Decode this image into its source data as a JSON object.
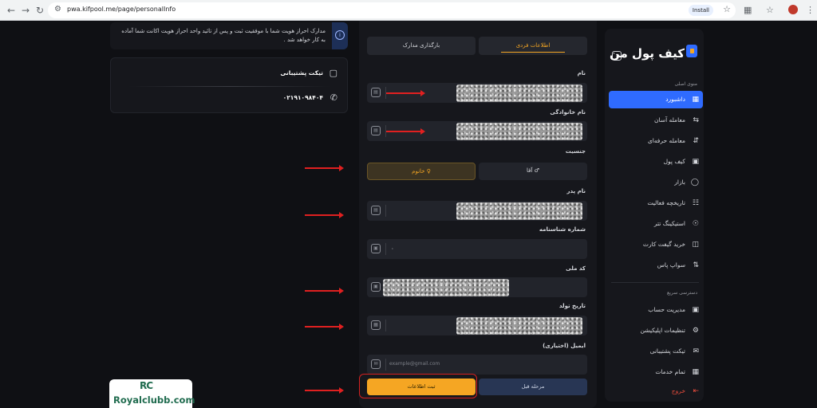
{
  "browser": {
    "url": "pwa.kifpool.me/page/personalInfo",
    "install_label": "Install",
    "back_icon": "arrow-left-icon",
    "forward_icon": "arrow-right-icon",
    "reload_icon": "reload-icon"
  },
  "sidebar": {
    "brand": "کیف پول من",
    "section_main": "منوی اصلی",
    "section_quick": "دسترسی سریع",
    "accent": "#2f6bff",
    "items": [
      {
        "label": "داشبورد",
        "icon": "dashboard-icon",
        "active": true
      },
      {
        "label": "معامله آسان",
        "icon": "easy-trade-icon"
      },
      {
        "label": "معامله حرفه‌ای",
        "icon": "pro-trade-icon"
      },
      {
        "label": "کیف پول",
        "icon": "wallet-icon"
      },
      {
        "label": "بازار",
        "icon": "market-icon"
      },
      {
        "label": "تاریخچه فعالیت",
        "icon": "history-icon"
      },
      {
        "label": "استیکینگ تتر",
        "icon": "staking-icon"
      },
      {
        "label": "خرید گیفت کارت",
        "icon": "gift-card-icon"
      },
      {
        "label": "سواپ پاس",
        "icon": "swap-icon"
      }
    ],
    "quick_items": [
      {
        "label": "مدیریت حساب",
        "icon": "account-icon"
      },
      {
        "label": "تنظیمات اپلیکیشن",
        "icon": "settings-icon"
      },
      {
        "label": "تیکت پشتیبانی",
        "icon": "ticket-icon"
      },
      {
        "label": "تمام خدمات",
        "icon": "grid-icon"
      }
    ],
    "logout": "خروج"
  },
  "form": {
    "tabs": {
      "personal": "اطلاعات فردی",
      "documents": "بارگذاری مدارک"
    },
    "active_tab": "personal",
    "labels": {
      "first_name": "نام",
      "last_name": "نام خانوادگی",
      "gender": "جنسیت",
      "father_name": "نام پدر",
      "id_number": "شماره شناسنامه",
      "national_code": "کد ملی",
      "birth_date": "تاریخ تولد",
      "email": "ایمیل (اختیاری)"
    },
    "id_number_value": "۰",
    "email_placeholder": "example@gmail.com",
    "gender_options": {
      "male": "آقا",
      "female": "خانوم"
    },
    "gender_selected": "female",
    "prev_button": "مرحله قبل",
    "submit_button": "ثبت اطلاعات",
    "accent": "#f5a623"
  },
  "notice": {
    "text": "مدارک احراز هویت شما با موفقیت ثبت و پس از تائید واحد احراز هویت اکانت شما آماده به کار خواهد شد .",
    "icon": "info-icon"
  },
  "support": {
    "ticket_label": "تیکت پشتیبانی",
    "phone": "۰۲۱۹۱۰۹۸۴۰۴",
    "ticket_icon": "chat-icon",
    "phone_icon": "phone-icon"
  },
  "watermark": {
    "mark": "RC",
    "text": "Royalclubb.com"
  }
}
